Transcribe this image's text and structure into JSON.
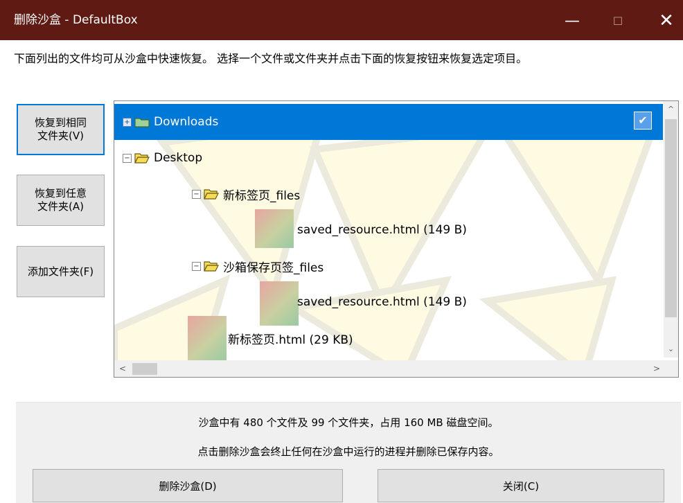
{
  "window": {
    "title": "删除沙盒 - DefaultBox",
    "minimize_glyph": "—",
    "maximize_glyph": "☐",
    "close_glyph": "✕"
  },
  "instruction": "下面列出的文件均可从沙盒中快速恢复。 选择一个文件或文件夹并点击下面的恢复按钮来恢复选定项目。",
  "side_buttons": {
    "recover_same_line1": "恢复到相同",
    "recover_same_line2": "文件夹(V)",
    "recover_any_line1": "恢复到任意",
    "recover_any_line2": "文件夹(A)",
    "add_folder": "添加文件夹(F)"
  },
  "tree": {
    "items": [
      {
        "label": "Downloads",
        "kind": "folder",
        "expander": "+",
        "selected": true,
        "checked": true
      },
      {
        "label": "Desktop",
        "kind": "folder",
        "expander": "−"
      },
      {
        "label": "新标签页_files",
        "kind": "folder",
        "expander": "−"
      },
      {
        "label": "saved_resource.html  (149 B)",
        "kind": "file"
      },
      {
        "label": "沙箱保存页签_files",
        "kind": "folder",
        "expander": "−"
      },
      {
        "label": "saved_resource.html  (149 B)",
        "kind": "file"
      },
      {
        "label": "新标签页.html  (29 KB)",
        "kind": "file"
      }
    ],
    "check_glyph": "✔"
  },
  "scrollbar": {
    "up": "^",
    "down": "⌄",
    "left": "<",
    "right": ">"
  },
  "footer": {
    "summary_line1": "沙盒中有 480 个文件及 99 个文件夹，占用 160 MB 磁盘空间。",
    "summary_line2": "点击删除沙盒会终止任何在沙盒中运行的进程并删除已保存内容。",
    "delete_button": "删除沙盒(D)",
    "close_button": "关闭(C)"
  },
  "colors": {
    "titlebar": "#5f1b13",
    "selection": "#0078d7",
    "folder_yellow": "#f7dc5a",
    "folder_green": "#9fd19a"
  }
}
